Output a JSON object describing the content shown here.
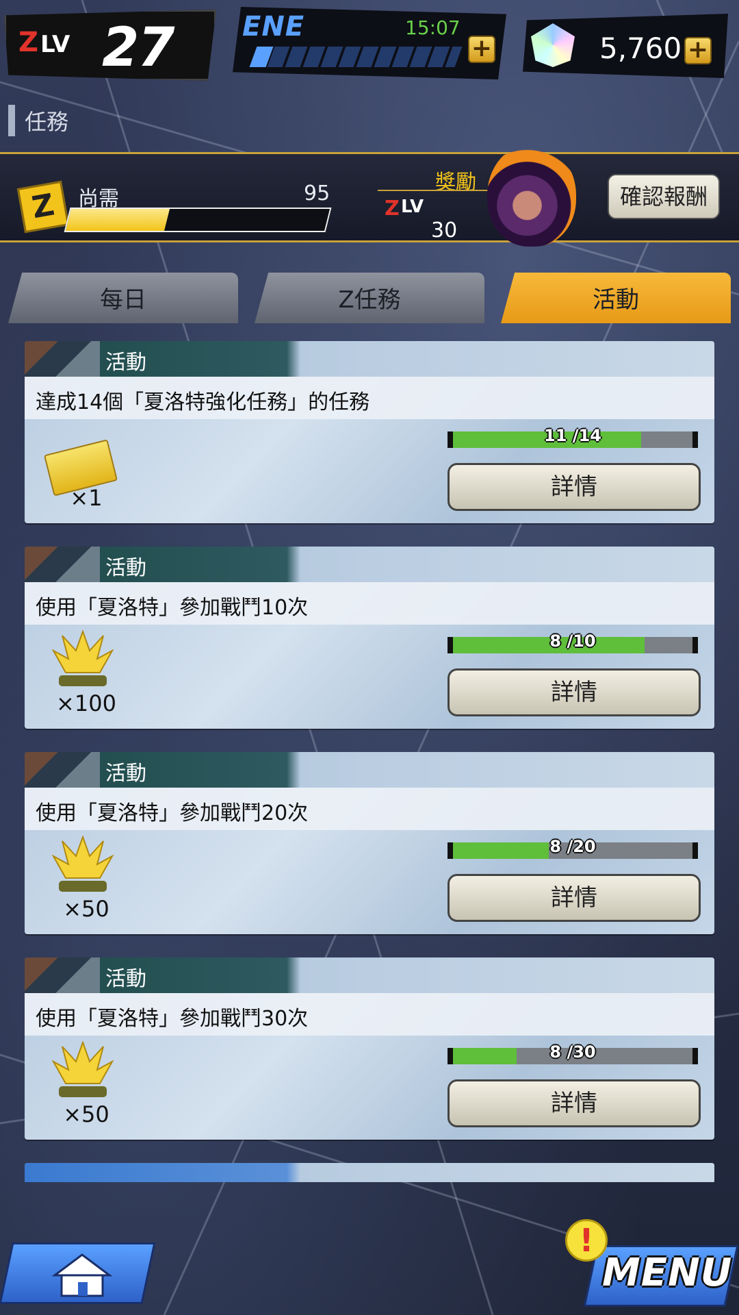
{
  "status": {
    "zlv_z": "Z",
    "zlv_label": "LV",
    "zlv_value": "27",
    "energy_label": "ENE",
    "energy_time": "15:07",
    "energy_fraction": 0.08,
    "gems": "5,760"
  },
  "section_title": "任務",
  "reward_banner": {
    "need_label": "尚需",
    "need_value": "95",
    "need_fraction": 0.38,
    "reward_label": "獎勵",
    "reward_z": "Z",
    "reward_lv": "LV",
    "reward_level": "30",
    "confirm_label": "確認報酬"
  },
  "tabs": [
    {
      "label": "每日",
      "active": false
    },
    {
      "label": "Z任務",
      "active": false
    },
    {
      "label": "活動",
      "active": true
    }
  ],
  "missions": [
    {
      "tag": "活動",
      "title": "達成14個「夏洛特強化任務」的任務",
      "reward_icon": "ticket-icon",
      "qty": "×1",
      "progress": "11 /14",
      "current": 11,
      "total": 14,
      "button": "詳情"
    },
    {
      "tag": "活動",
      "title": "使用「夏洛特」參加戰鬥10次",
      "reward_icon": "aura-icon",
      "qty": "×100",
      "progress": "8 /10",
      "current": 8,
      "total": 10,
      "button": "詳情"
    },
    {
      "tag": "活動",
      "title": "使用「夏洛特」參加戰鬥20次",
      "reward_icon": "aura-icon",
      "qty": "×50",
      "progress": "8 /20",
      "current": 8,
      "total": 20,
      "button": "詳情"
    },
    {
      "tag": "活動",
      "title": "使用「夏洛特」參加戰鬥30次",
      "reward_icon": "aura-icon",
      "qty": "×50",
      "progress": "8 /30",
      "current": 8,
      "total": 30,
      "button": "詳情"
    }
  ],
  "bottom_nav": {
    "menu_label": "MENU",
    "alert_mark": "!"
  },
  "colors": {
    "accent_gold": "#f2c31a",
    "tab_active": "#f7b93a",
    "progress_green": "#5fbe3a",
    "energy_blue": "#5aa0ff"
  }
}
